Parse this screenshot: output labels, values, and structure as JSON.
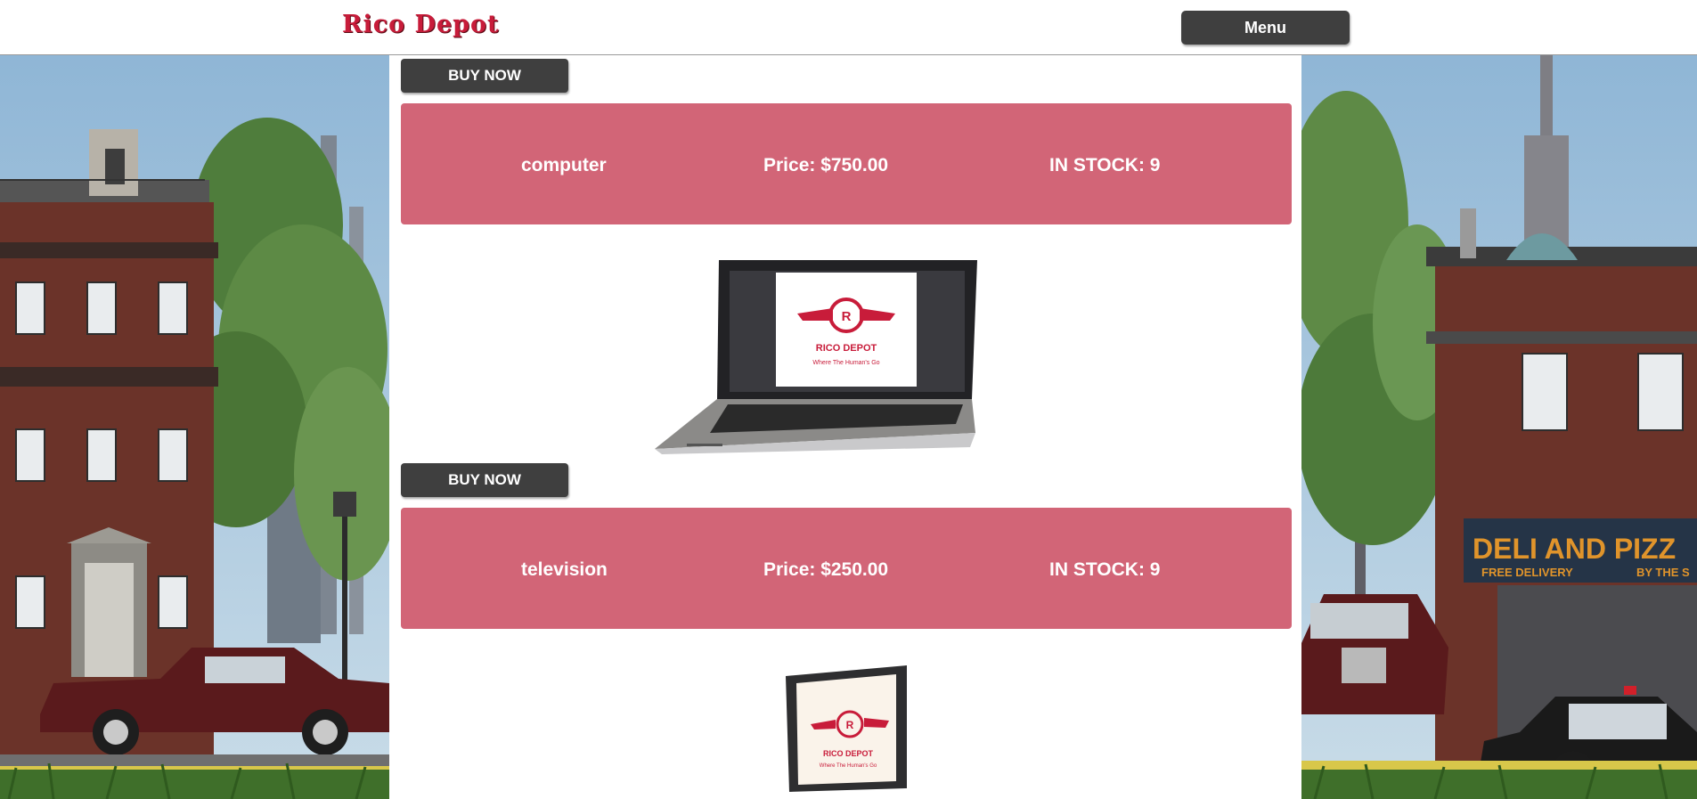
{
  "header": {
    "logo": "Rico Depot",
    "menu_label": "Menu"
  },
  "products": [
    {
      "buy_label": "BUY NOW",
      "name": "computer",
      "price": "Price: $750.00",
      "stock": "IN STOCK: 9",
      "image_brand": "RICO DEPOT",
      "image_tagline": "Where The Human's Go",
      "image_emblem_letter": "R"
    },
    {
      "buy_label": "BUY NOW",
      "name": "television",
      "price": "Price: $250.00",
      "stock": "IN STOCK: 9",
      "image_brand": "RICO DEPOT",
      "image_tagline": "Where The Human's Go",
      "image_emblem_letter": "R"
    }
  ],
  "scenery": {
    "storefront_sign": "DELI AND PIZZ",
    "storefront_sub_left": "FREE DELIVERY",
    "storefront_sub_right": "BY THE S"
  },
  "colors": {
    "card": "#d26577",
    "button": "#3f3f3f",
    "brand_red": "#c81c3a"
  }
}
